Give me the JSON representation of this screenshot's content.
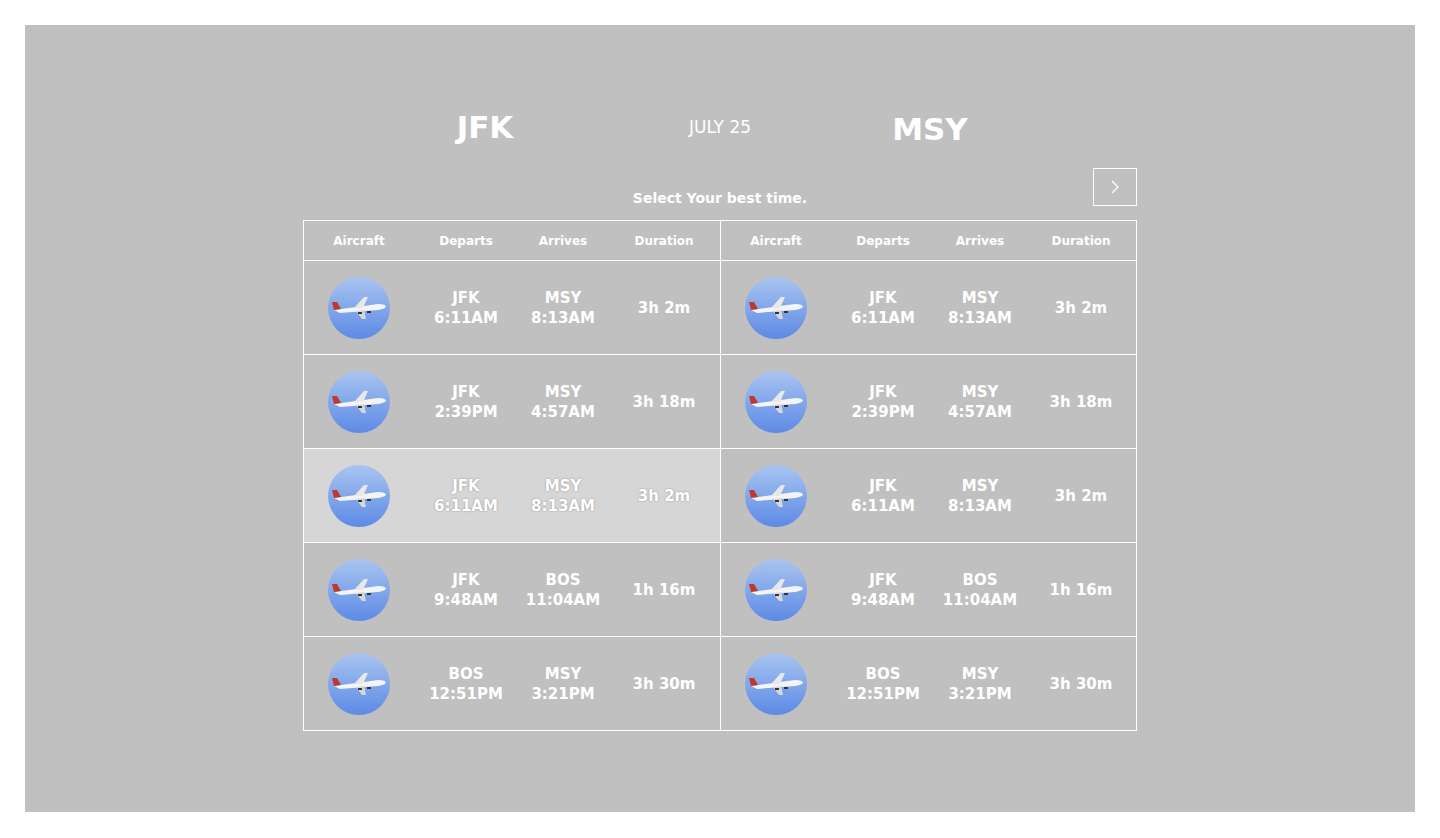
{
  "header": {
    "origin": "JFK",
    "date": "JULY 25",
    "destination": "MSY"
  },
  "prompt": "Select Your best time.",
  "panels": [
    {
      "columns": [
        "Aircraft",
        "Departs",
        "Arrives",
        "Duration"
      ],
      "rows": [
        {
          "from": "JFK",
          "departs": "6:11AM",
          "to": "MSY",
          "arrives": "8:13AM",
          "duration": "3h 2m",
          "selected": false
        },
        {
          "from": "JFK",
          "departs": "2:39PM",
          "to": "MSY",
          "arrives": "4:57AM",
          "duration": "3h 18m",
          "selected": false
        },
        {
          "from": "JFK",
          "departs": "6:11AM",
          "to": "MSY",
          "arrives": "8:13AM",
          "duration": "3h 2m",
          "selected": true
        },
        {
          "from": "JFK",
          "departs": "9:48AM",
          "to": "BOS",
          "arrives": "11:04AM",
          "duration": "1h 16m",
          "selected": false
        },
        {
          "from": "BOS",
          "departs": "12:51PM",
          "to": "MSY",
          "arrives": "3:21PM",
          "duration": "3h 30m",
          "selected": false
        }
      ]
    },
    {
      "columns": [
        "Aircraft",
        "Departs",
        "Arrives",
        "Duration"
      ],
      "rows": [
        {
          "from": "JFK",
          "departs": "6:11AM",
          "to": "MSY",
          "arrives": "8:13AM",
          "duration": "3h 2m",
          "selected": false
        },
        {
          "from": "JFK",
          "departs": "2:39PM",
          "to": "MSY",
          "arrives": "4:57AM",
          "duration": "3h 18m",
          "selected": false
        },
        {
          "from": "JFK",
          "departs": "6:11AM",
          "to": "MSY",
          "arrives": "8:13AM",
          "duration": "3h 2m",
          "selected": false
        },
        {
          "from": "JFK",
          "departs": "9:48AM",
          "to": "BOS",
          "arrives": "11:04AM",
          "duration": "1h 16m",
          "selected": false
        },
        {
          "from": "BOS",
          "departs": "12:51PM",
          "to": "MSY",
          "arrives": "3:21PM",
          "duration": "3h 30m",
          "selected": false
        }
      ]
    }
  ]
}
